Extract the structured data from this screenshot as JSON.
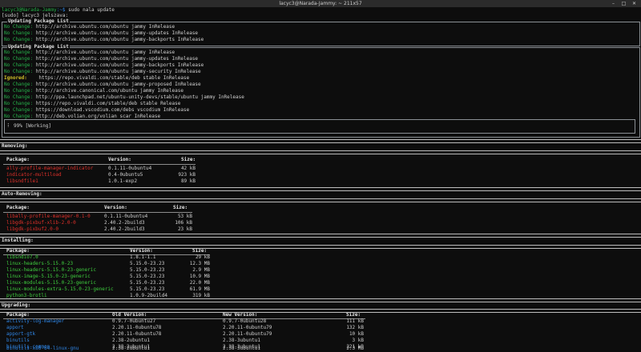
{
  "window": {
    "title": "lacyc3@Narada-Jammy: ~ 211x57"
  },
  "prompt": {
    "user": "lacyc3@Narada-Jammy",
    "path": ":~$",
    "command": " sudo nala update"
  },
  "sudo_prompt": "[sudo] lacyc3 jelszava:",
  "box1": {
    "title": "Updating Package List",
    "lines": [
      {
        "status": "No Change:",
        "url": "http://archive.ubuntu.com/ubuntu jammy InRelease"
      },
      {
        "status": "No Change:",
        "url": "http://archive.ubuntu.com/ubuntu jammy-updates InRelease"
      },
      {
        "status": "No Change:",
        "url": "http://archive.ubuntu.com/ubuntu jammy-backports InRelease"
      }
    ]
  },
  "box2": {
    "title": "Updating Package List",
    "lines": [
      {
        "status": "No Change:",
        "url": "http://archive.ubuntu.com/ubuntu jammy InRelease"
      },
      {
        "status": "No Change:",
        "url": "http://archive.ubuntu.com/ubuntu jammy-updates InRelease"
      },
      {
        "status": "No Change:",
        "url": "http://archive.ubuntu.com/ubuntu jammy-backports InRelease"
      },
      {
        "status": "No Change:",
        "url": "http://archive.ubuntu.com/ubuntu jammy-security InRelease"
      },
      {
        "status": "Ignored:",
        "url": "   https://repo.vivaldi.com/stable/deb stable InRelease",
        "ignored": true
      },
      {
        "status": "No Change:",
        "url": "http://archive.ubuntu.com/ubuntu jammy-proposed InRelease"
      },
      {
        "status": "No Change:",
        "url": "http://archive.canonical.com/ubuntu jammy InRelease"
      },
      {
        "status": "No Change:",
        "url": "http://ppa.launchpad.net/ubuntu-unity-devs/stable/ubuntu jammy InRelease"
      },
      {
        "status": "No Change:",
        "url": "https://repo.vivaldi.com/stable/deb stable Release"
      },
      {
        "status": "No Change:",
        "url": "https://download.vscodium.com/debs vscodium InRelease"
      },
      {
        "status": "No Change:",
        "url": "http://deb.volian.org/volian scar InRelease"
      }
    ],
    "progress": "⠇ 99% [Working]"
  },
  "removing": {
    "heading": "Removing:",
    "headers": {
      "package": "Package:",
      "version": "Version:",
      "size": "Size:"
    },
    "rows": [
      {
        "package": "ally-profile-manager-indicator",
        "version": "0.1.11-0ubuntu4",
        "size": "42 kB"
      },
      {
        "package": "indicator-multiload",
        "version": "0.4-0ubuntu5",
        "size": "923 kB"
      },
      {
        "package": "libsndfile1",
        "version": "1.0.1-exp2",
        "size": "89 kB"
      }
    ]
  },
  "auto_removing": {
    "heading": "Auto-Removing:",
    "headers": {
      "package": "Package:",
      "version": "Version:",
      "size": "Size:"
    },
    "rows": [
      {
        "package": "libally-profile-manager-0.1-0",
        "version": "0.1.11-0ubuntu4",
        "size": "53 kB"
      },
      {
        "package": "libgdk-pixbuf-xlib-2.0-0",
        "version": "2.40.2-2build3",
        "size": "106 kB"
      },
      {
        "package": "libgdk-pixbuf2.0-0",
        "version": "2.40.2-2build3",
        "size": "23 kB"
      }
    ]
  },
  "installing": {
    "heading": "Installing:",
    "headers": {
      "package": "Package:",
      "version": "Version:",
      "size": "Size:"
    },
    "rows": [
      {
        "package": "libsndio7.0",
        "version": "1.8.1-1.1",
        "size": "29 kB"
      },
      {
        "package": "linux-headers-5.15.0-23",
        "version": "5.15.0-23.23",
        "size": "12.3 MB"
      },
      {
        "package": "linux-headers-5.15.0-23-generic",
        "version": "5.15.0-23.23",
        "size": "2.9 MB"
      },
      {
        "package": "linux-image-5.15.0-23-generic",
        "version": "5.15.0-23.23",
        "size": "10.9 MB"
      },
      {
        "package": "linux-modules-5.15.0-23-generic",
        "version": "5.15.0-23.23",
        "size": "22.0 MB"
      },
      {
        "package": "linux-modules-extra-5.15.0-23-generic",
        "version": "5.15.0-23.23",
        "size": "61.9 MB"
      },
      {
        "package": "python3-brotli",
        "version": "1.0.9-2build4",
        "size": "319 kB"
      }
    ]
  },
  "upgrading": {
    "heading": "Upgrading:",
    "headers": {
      "package": "Package:",
      "old": "Old Version:",
      "new": "New Version:",
      "size": "Size:"
    },
    "rows": [
      {
        "package": "activity-log-manager",
        "old": "0.9.7-0ubuntu27",
        "new": "0.9.7-0ubuntu28",
        "size": "111 kB"
      },
      {
        "package": "apport",
        "old": "2.20.11-0ubuntu78",
        "new": "2.20.11-0ubuntu79",
        "size": "132 kB"
      },
      {
        "package": "apport-gtk",
        "old": "2.20.11-0ubuntu78",
        "new": "2.20.11-0ubuntu79",
        "size": "10 kB"
      },
      {
        "package": "binutils",
        "old": "2.38-2ubuntu1",
        "new": "2.38-3ubuntu1",
        "size": "3 kB"
      },
      {
        "package": "binutils-common",
        "old": "2.38-2ubuntu1",
        "new": "2.38-3ubuntu1",
        "size": "221 kB"
      },
      {
        "package": "binutils-x86-64-linux-gnu",
        "old": "2.38-2ubuntu1",
        "new": "2.38-3ubuntu1",
        "size": "2.3 MB"
      }
    ]
  },
  "colors": {
    "background": "#0d0d0d",
    "green": "#27b04a",
    "yellow": "#d2c128",
    "red": "#e0302a",
    "light_green": "#3fcf3f",
    "blue": "#2f86e6"
  }
}
